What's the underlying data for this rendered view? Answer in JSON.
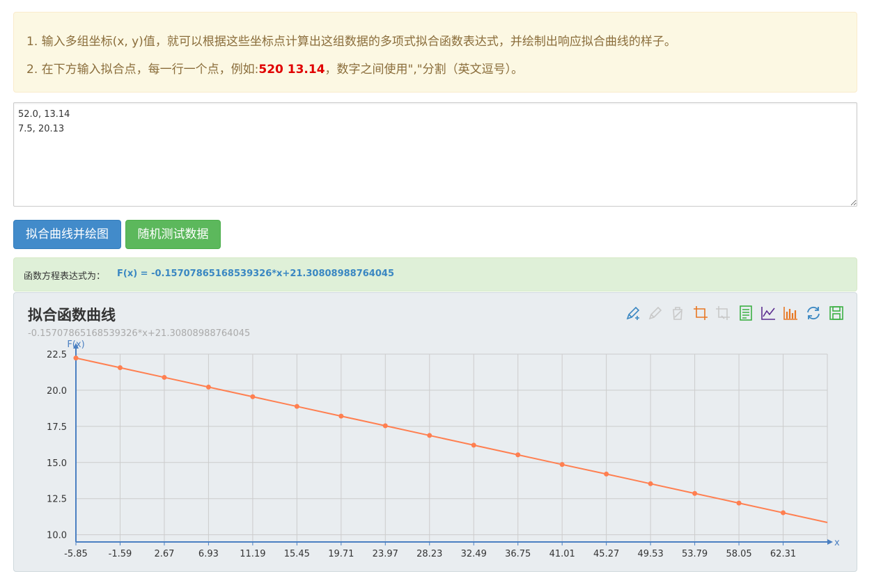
{
  "notice": {
    "line1": "1. 输入多组坐标(x, y)值，就可以根据这些坐标点计算出这组数据的多项式拟合函数表达式，并绘制出响应拟合曲线的样子。",
    "line2_prefix": "2. 在下方输入拟合点，每一行一个点，例如:",
    "line2_example": "520 13.14",
    "line2_suffix": "，数字之间使用\",\"分割（英文逗号）。"
  },
  "input": {
    "value": "52.0, 13.14\n7.5, 20.13"
  },
  "buttons": {
    "fit": "拟合曲线并绘图",
    "random": "随机测试数据"
  },
  "result": {
    "label": "函数方程表达式为：",
    "equation": "F(x) = -0.15707865168539326*x+21.30808988764045"
  },
  "chart_panel": {
    "title": "拟合函数曲线",
    "subtitle": "-0.15707865168539326*x+21.30808988764045",
    "toolbox": [
      "brush-pencil-icon",
      "brush-clear-icon",
      "brush-delete-icon",
      "area-zoom-icon",
      "zoom-reset-icon",
      "data-view-icon",
      "line-type-icon",
      "bar-type-icon",
      "restore-icon",
      "save-image-icon"
    ]
  },
  "chart_data": {
    "type": "line",
    "title": "拟合函数曲线",
    "subtitle": "-0.15707865168539326*x+21.30808988764045",
    "xlabel": "x",
    "ylabel": "F(x)",
    "x": [
      -5.85,
      -1.59,
      2.67,
      6.93,
      11.19,
      15.45,
      19.71,
      23.97,
      28.23,
      32.49,
      36.75,
      41.01,
      45.27,
      49.53,
      53.79,
      58.05,
      62.31
    ],
    "y_axis_ticks": [
      10.0,
      12.5,
      15.0,
      17.5,
      20.0,
      22.5
    ],
    "series": [
      {
        "values": [
          22.23,
          21.56,
          20.89,
          20.22,
          19.55,
          18.88,
          18.21,
          17.54,
          16.87,
          16.2,
          15.53,
          14.86,
          14.2,
          13.53,
          12.86,
          12.19,
          11.52
        ]
      }
    ],
    "line_end": {
      "x": 66.57,
      "y": 10.85
    },
    "xlim": [
      -5.85,
      66.57
    ],
    "ylim": [
      9.5,
      22.5
    ],
    "grid": true,
    "colors": {
      "line": "#ff7f50",
      "axis": "#4a7fc1",
      "grid": "#cccccc",
      "toolbar_blue": "#3a87c2",
      "toolbar_orange": "#e87722",
      "toolbar_green": "#3cb043",
      "toolbar_purple": "#5b2c8f",
      "toolbar_disabled": "#c8c8c8"
    }
  }
}
